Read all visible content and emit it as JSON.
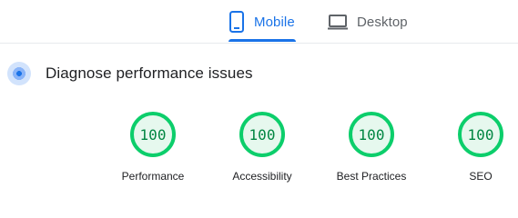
{
  "tabs": {
    "mobile": {
      "label": "Mobile",
      "icon": "smartphone-icon",
      "active": true
    },
    "desktop": {
      "label": "Desktop",
      "icon": "desktop-icon",
      "active": false
    }
  },
  "diagnose": {
    "title": "Diagnose performance issues",
    "icon": "performance-diagnose-icon"
  },
  "gauges": [
    {
      "name": "Performance",
      "score": "100"
    },
    {
      "name": "Accessibility",
      "score": "100"
    },
    {
      "name": "Best Practices",
      "score": "100"
    },
    {
      "name": "SEO",
      "score": "100"
    }
  ],
  "colors": {
    "accent": "#1a73e8",
    "pass_ring": "#0cce6b",
    "pass_fill": "#e6f8ee",
    "pass_text": "#018642"
  }
}
